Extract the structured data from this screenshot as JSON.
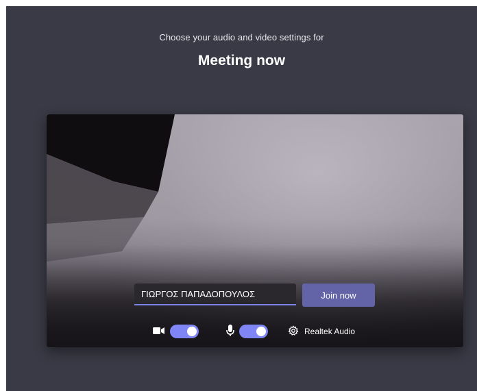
{
  "header": {
    "subtitle": "Choose your audio and video settings for",
    "meeting_title": "Meeting now"
  },
  "prejoin": {
    "name_input_value": "ΓΙΩΡΓΟΣ ΠΑΠΑΔΟΠΟΥΛΟΣ",
    "join_label": "Join now"
  },
  "devices": {
    "camera_icon": "video-camera-icon",
    "camera_on": true,
    "mic_icon": "microphone-icon",
    "mic_on": true,
    "settings_icon": "gear-icon",
    "audio_device_label": "Realtek Audio"
  },
  "colors": {
    "background": "#3a3a46",
    "accent": "#6264a7",
    "toggle_on": "#7f85f5"
  }
}
